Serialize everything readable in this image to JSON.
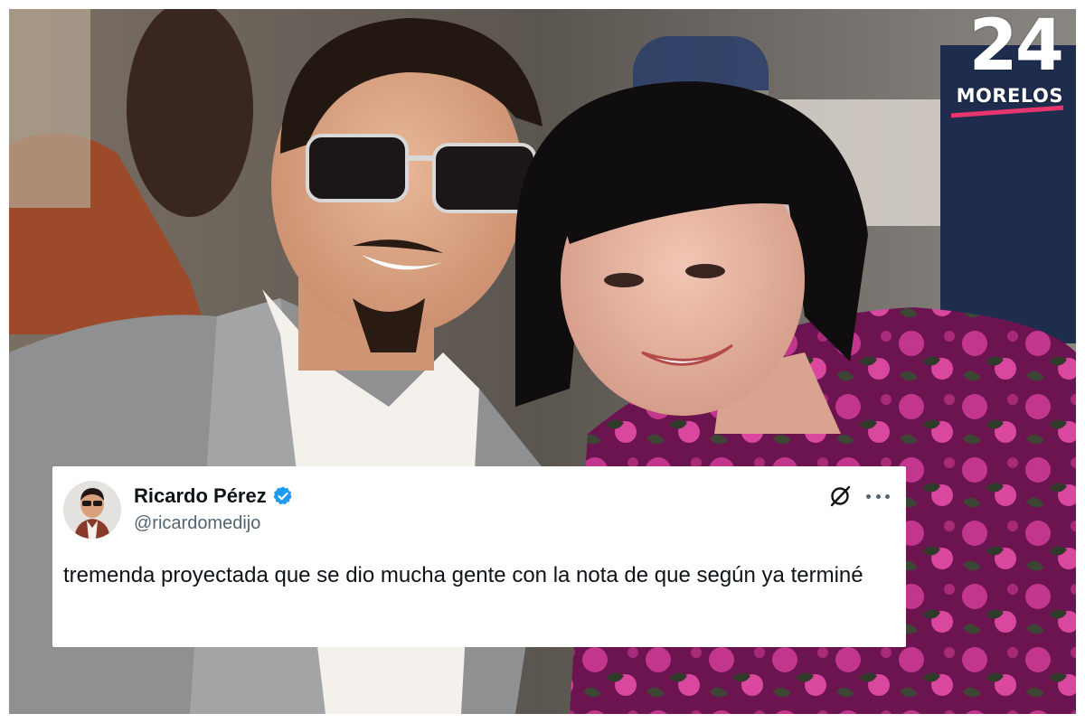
{
  "logo": {
    "number": "24",
    "word": "MORELOS"
  },
  "tweet": {
    "display_name": "Ricardo Pérez",
    "handle": "@ricardomedijo",
    "verified": true,
    "text": "tremenda proyectada que se dio mucha gente con la nota de que según ya terminé"
  },
  "icons": {
    "verified": "verified-badge-icon",
    "grok": "grok-icon",
    "more": "more-options-icon",
    "avatar": "avatar"
  },
  "colors": {
    "verified_blue": "#1d9bf0",
    "name_text": "#0f1419",
    "handle_text": "#536471",
    "logo_accent": "#e8356e"
  }
}
